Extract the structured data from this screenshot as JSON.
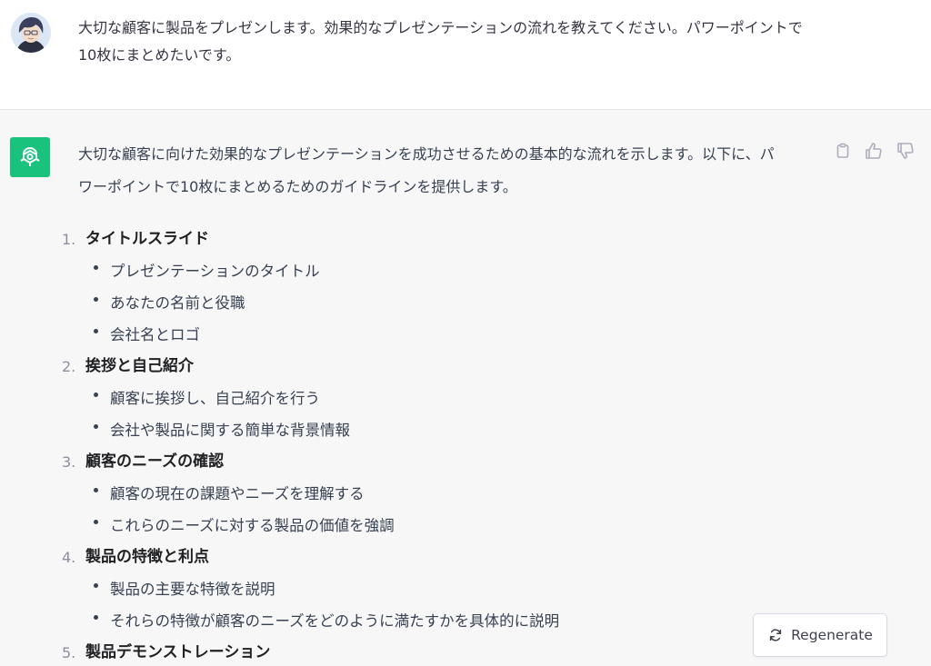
{
  "user_message": {
    "line1": "大切な顧客に製品をプレゼンします。効果的なプレゼンテーションの流れを教えてください。パワーポイントで",
    "line2": "10枚にまとめたいです。"
  },
  "assistant_message": {
    "line1": "大切な顧客に向けた効果的なプレゼンテーションを成功させるための基本的な流れを示します。以下に、パ",
    "line2": "ワーポイントで10枚にまとめるためのガイドラインを提供します。",
    "items": [
      {
        "number": "1.",
        "title": "タイトルスライド",
        "bullets": [
          "プレゼンテーションのタイトル",
          "あなたの名前と役職",
          "会社名とロゴ"
        ]
      },
      {
        "number": "2.",
        "title": "挨拶と自己紹介",
        "bullets": [
          "顧客に挨拶し、自己紹介を行う",
          "会社や製品に関する簡単な背景情報"
        ]
      },
      {
        "number": "3.",
        "title": "顧客のニーズの確認",
        "bullets": [
          "顧客の現在の課題やニーズを理解する",
          "これらのニーズに対する製品の価値を強調"
        ]
      },
      {
        "number": "4.",
        "title": "製品の特徴と利点",
        "bullets": [
          "製品の主要な特徴を説明",
          "それらの特徴が顧客のニーズをどのように満たすかを具体的に説明"
        ]
      },
      {
        "number": "5.",
        "title": "製品デモンストレーション",
        "bullets": []
      }
    ]
  },
  "actions": {
    "icons": [
      "clipboard-icon",
      "thumbs-up-icon",
      "thumbs-down-icon"
    ]
  },
  "regenerate": {
    "label": "Regenerate",
    "icon": "refresh-icon"
  },
  "colors": {
    "assistant_logo_bg": "#19c37d",
    "page_bg": "#f7f7f8",
    "user_bg": "#ffffff"
  }
}
